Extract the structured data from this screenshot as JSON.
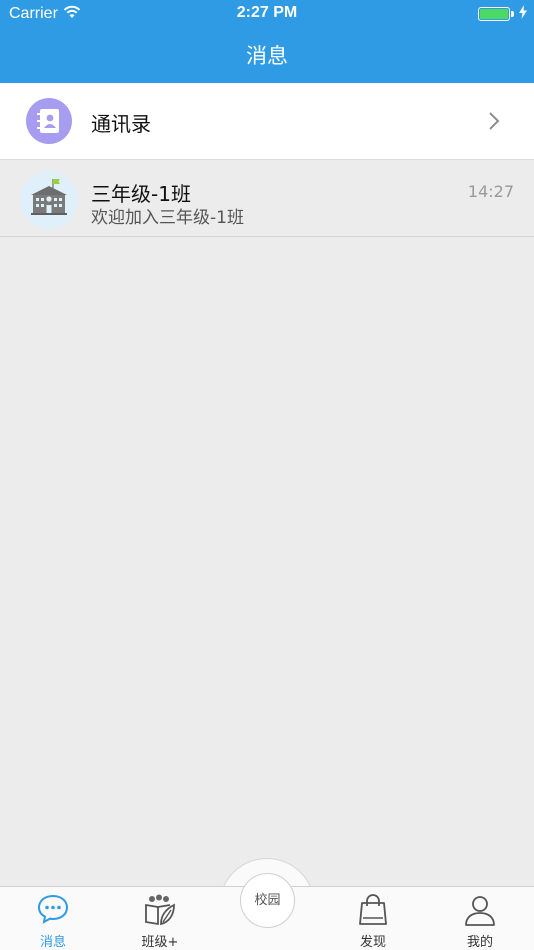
{
  "status_bar": {
    "carrier": "Carrier",
    "time": "2:27 PM"
  },
  "header": {
    "title": "消息"
  },
  "contacts": {
    "label": "通讯录",
    "icon": "address-book-icon"
  },
  "conversations": [
    {
      "title": "三年级-1班",
      "preview": "欢迎加入三年级-1班",
      "time": "14:27",
      "icon": "school-building-icon"
    }
  ],
  "tabbar": {
    "tabs": [
      {
        "label": "消息",
        "icon": "chat-bubble-icon",
        "active": true
      },
      {
        "label": "班级+",
        "icon": "class-plus-icon",
        "active": false
      },
      {
        "label": "校园",
        "icon": "campus-button",
        "active": false
      },
      {
        "label": "发现",
        "icon": "shopping-bag-icon",
        "active": false
      },
      {
        "label": "我的",
        "icon": "user-icon",
        "active": false
      }
    ]
  },
  "colors": {
    "accent": "#2f9be4",
    "contacts_icon_bg": "#a69cf0",
    "background": "#ececec"
  }
}
